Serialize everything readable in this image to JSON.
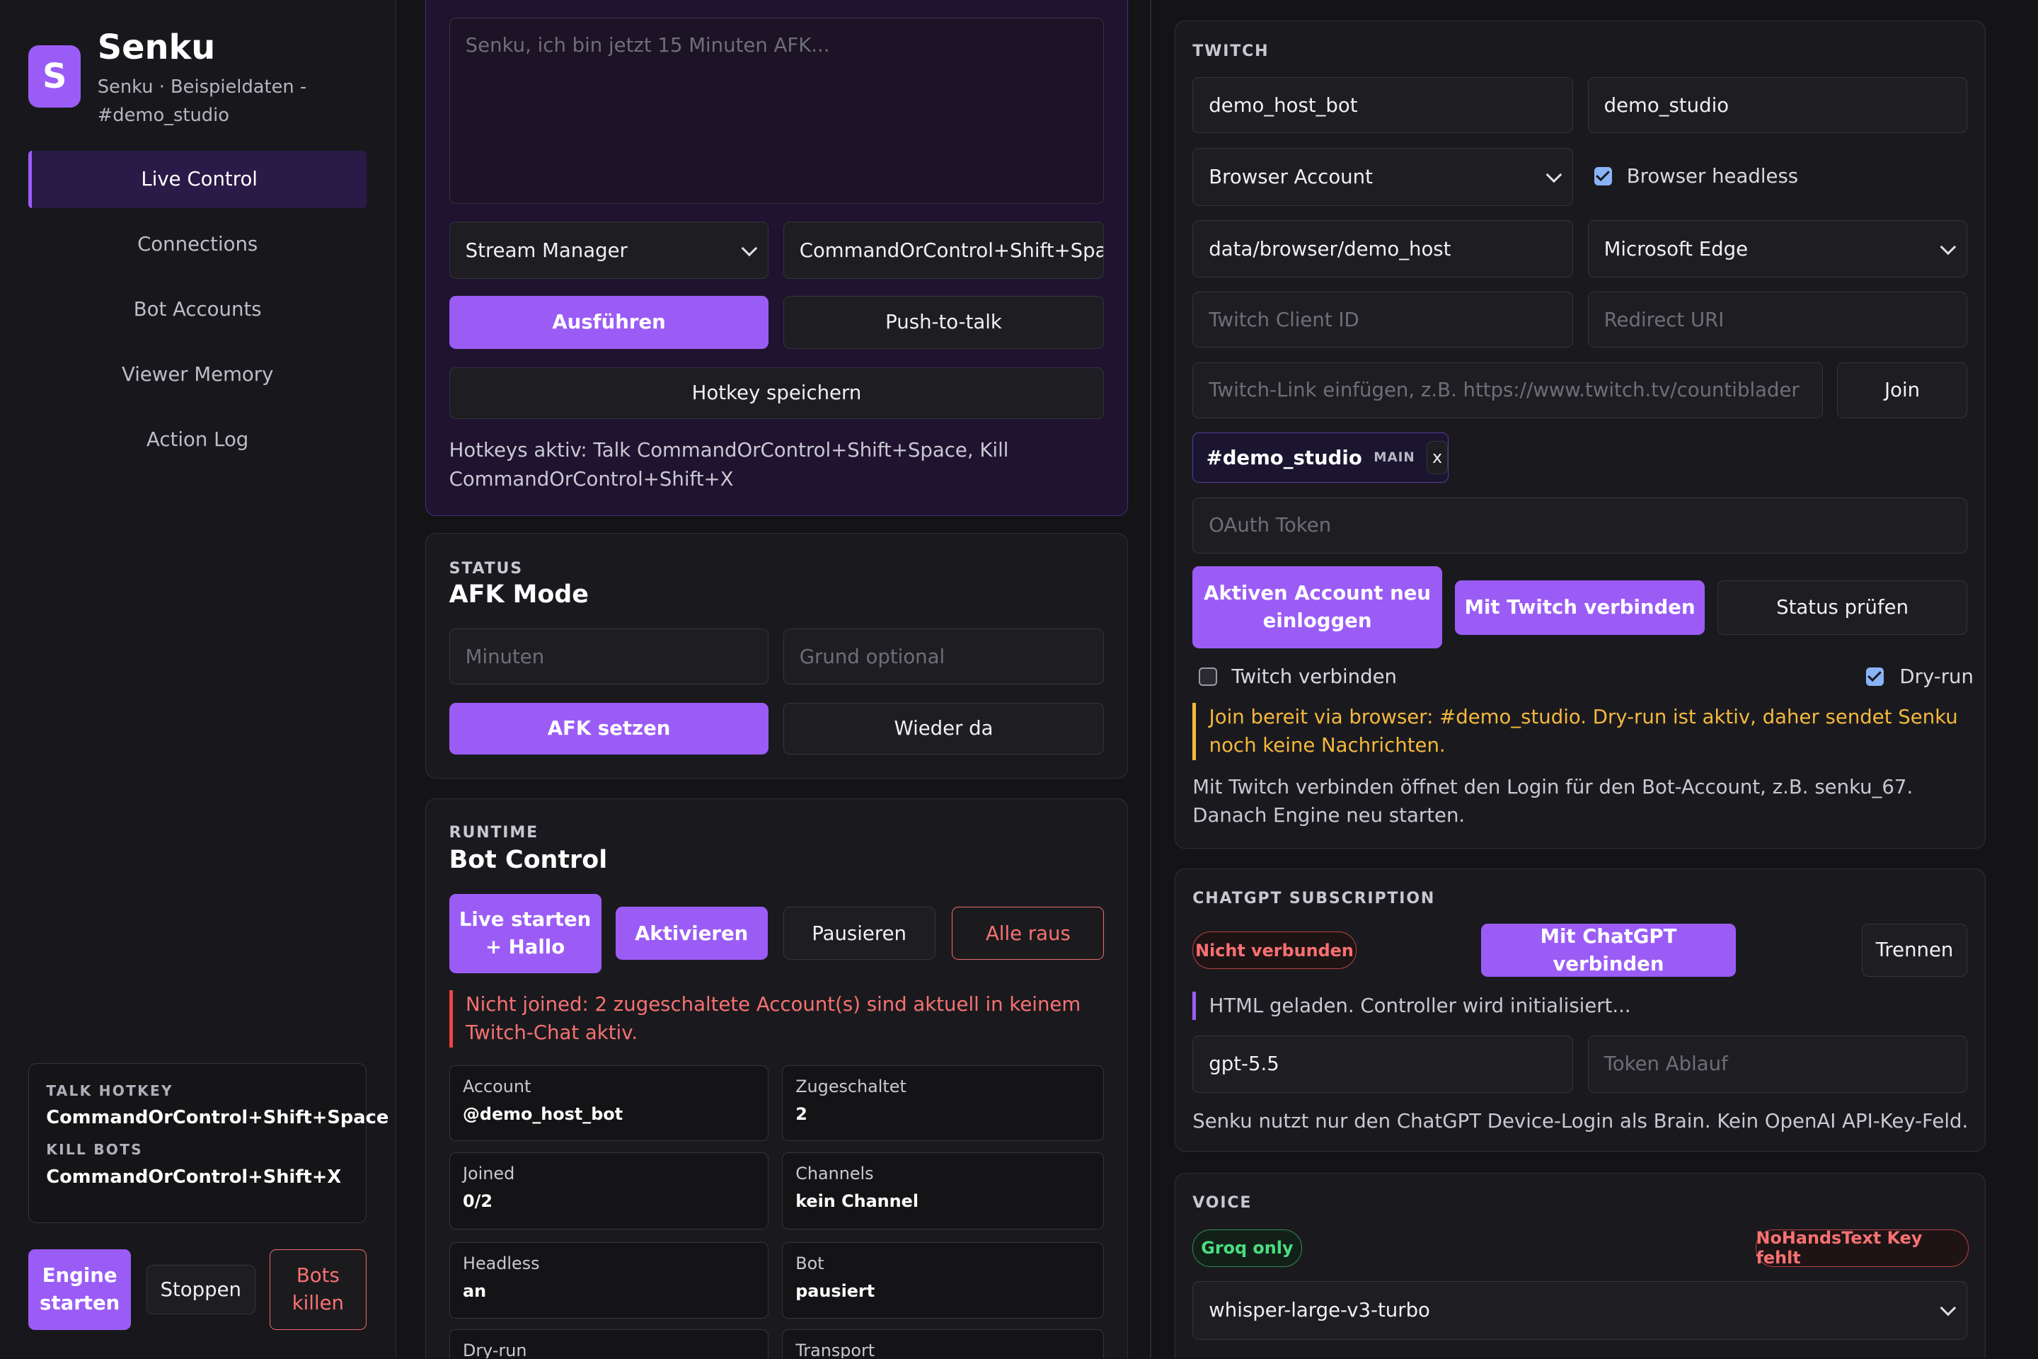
{
  "brand": {
    "logo_letter": "S",
    "title": "Senku",
    "subtitle": "Senku · Beispieldaten - #demo_studio"
  },
  "nav": [
    {
      "label": "Live Control",
      "active": true
    },
    {
      "label": "Connections"
    },
    {
      "label": "Bot Accounts"
    },
    {
      "label": "Viewer Memory"
    },
    {
      "label": "Action Log"
    }
  ],
  "hotkeys_box": {
    "talk_label": "TALK HOTKEY",
    "talk_value": "CommandOrControl+Shift+Space",
    "kill_label": "KILL BOTS",
    "kill_value": "CommandOrControl+Shift+X"
  },
  "engine": {
    "start": "Engine starten",
    "stop": "Stoppen",
    "kill": "Bots killen"
  },
  "command": {
    "textarea_placeholder": "Senku, ich bin jetzt 15 Minuten AFK...",
    "target_select": "Stream Manager",
    "hotkey_input": "CommandOrControl+Shift+Space",
    "run": "Ausführen",
    "ptt": "Push-to-talk",
    "save_hotkey": "Hotkey speichern",
    "hotkeys_active": "Hotkeys aktiv: Talk CommandOrControl+Shift+Space, Kill CommandOrControl+Shift+X"
  },
  "status": {
    "label": "STATUS",
    "title": "AFK Mode",
    "minutes_placeholder": "Minuten",
    "reason_placeholder": "Grund optional",
    "set_afk": "AFK setzen",
    "back": "Wieder da"
  },
  "runtime": {
    "label": "RUNTIME",
    "title": "Bot Control",
    "start_live": "Live starten + Hallo",
    "activate": "Aktivieren",
    "pause": "Pausieren",
    "all_out": "Alle raus",
    "warning": "Nicht joined: 2 zugeschaltete Account(s) sind aktuell in keinem Twitch-Chat aktiv.",
    "stats": [
      {
        "k": "Account",
        "v": "@demo_host_bot"
      },
      {
        "k": "Zugeschaltet",
        "v": "2"
      },
      {
        "k": "Joined",
        "v": "0/2"
      },
      {
        "k": "Channels",
        "v": "kein Channel"
      },
      {
        "k": "Headless",
        "v": "an"
      },
      {
        "k": "Bot",
        "v": "pausiert"
      },
      {
        "k": "Dry-run",
        "v": ""
      },
      {
        "k": "Transport",
        "v": ""
      }
    ]
  },
  "twitch": {
    "label": "TWITCH",
    "bot_name": "demo_host_bot",
    "channel": "demo_studio",
    "account_select": "Browser Account",
    "headless_label": "Browser headless",
    "profile_path": "data/browser/demo_host",
    "browser_select": "Microsoft Edge",
    "client_id_placeholder": "Twitch Client ID",
    "redirect_placeholder": "Redirect URI",
    "link_placeholder": "Twitch-Link einfügen, z.B. https://www.twitch.tv/countiblader",
    "join": "Join",
    "chip_name": "#demo_studio",
    "chip_tag": "MAIN",
    "chip_remove": "x",
    "oauth_placeholder": "OAuth Token",
    "relogin": "Aktiven Account neu einloggen",
    "connect": "Mit Twitch verbinden",
    "check": "Status prüfen",
    "connect_check_label": "Twitch verbinden",
    "dryrun_label": "Dry-run",
    "info_warning": "Join bereit via browser: #demo_studio. Dry-run ist aktiv, daher sendet Senku noch keine Nachrichten.",
    "info": "Mit Twitch verbinden öffnet den Login für den Bot-Account, z.B. senku_67. Danach Engine neu starten."
  },
  "chatgpt": {
    "label": "CHATGPT SUBSCRIPTION",
    "status_pill": "Nicht verbunden",
    "connect": "Mit ChatGPT verbinden",
    "disconnect": "Trennen",
    "log": "HTML geladen. Controller wird initialisiert...",
    "model": "gpt-5.5",
    "expiry_placeholder": "Token Ablauf",
    "info": "Senku nutzt nur den ChatGPT Device-Login als Brain. Kein OpenAI API-Key-Feld."
  },
  "voice": {
    "label": "VOICE",
    "groq_pill": "Groq only",
    "nohands_pill": "NoHandsText Key fehlt",
    "model_select": "whisper-large-v3-turbo"
  }
}
